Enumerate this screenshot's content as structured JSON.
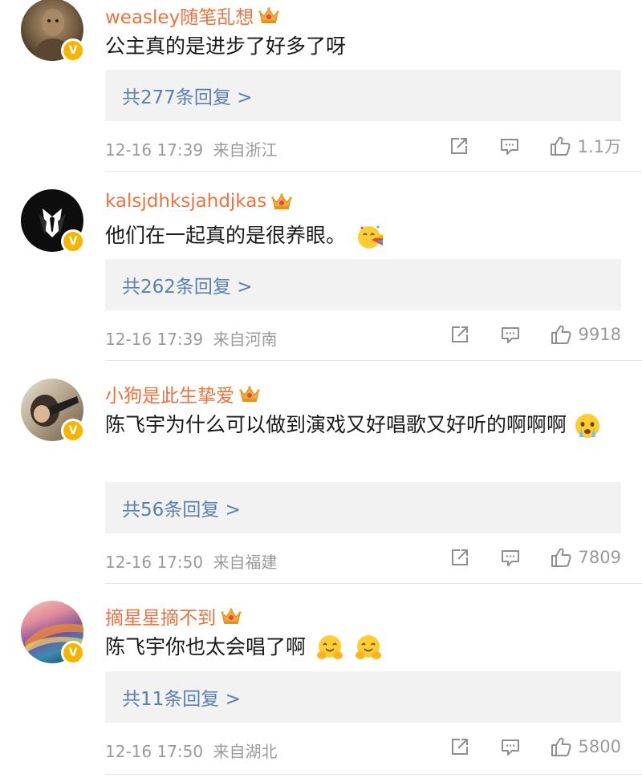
{
  "comments": [
    {
      "username": "weasley随笔乱想",
      "text": "公主真的是进步了好多了呀",
      "replies": "共277条回复 >",
      "time": "12-16 17:39",
      "source": "来自浙江",
      "likes": "1.1万"
    },
    {
      "username": "kalsjdhksjahdjkas",
      "text": "他们在一起真的是很养眼。",
      "replies": "共262条回复 >",
      "time": "12-16 17:39",
      "source": "来自河南",
      "likes": "9918"
    },
    {
      "username": "小狗是此生挚爱",
      "text": "陈飞宇为什么可以做到演戏又好唱歌又好听的啊啊啊",
      "replies": "共56条回复 >",
      "time": "12-16 17:50",
      "source": "来自福建",
      "likes": "7809"
    },
    {
      "username": "摘星星摘不到",
      "text": "陈飞宇你也太会唱了啊",
      "replies": "共11条回复 >",
      "time": "12-16 17:50",
      "source": "来自湖北",
      "likes": "5800"
    }
  ],
  "icons": {
    "verified": "verified-badge-icon",
    "crown": "vip-crown-icon",
    "share": "share-icon",
    "comment": "comment-icon",
    "like": "thumbs-up-icon"
  },
  "colors": {
    "username": "#eb7340",
    "reply_link": "#5b7fb0",
    "reply_bg": "#f2f2f2",
    "meta": "#9a9a9a",
    "badge": "#f7b500"
  }
}
